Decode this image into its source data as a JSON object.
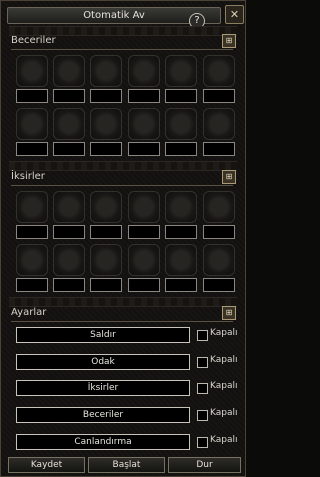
{
  "window": {
    "title": "Otomatik Av"
  },
  "sections": {
    "skills": {
      "label": "Beceriler"
    },
    "potions": {
      "label": "İksirler"
    },
    "settings": {
      "label": "Ayarlar"
    }
  },
  "settings": {
    "rows": [
      {
        "label": "Saldır",
        "status": "Kapalı"
      },
      {
        "label": "Odak",
        "status": "Kapalı"
      },
      {
        "label": "İksirler",
        "status": "Kapalı"
      },
      {
        "label": "Beceriler",
        "status": "Kapalı"
      },
      {
        "label": "Canlandırma",
        "status": "Kapalı"
      }
    ]
  },
  "footer": {
    "save": "Kaydet",
    "start": "Başlat",
    "stop": "Dur"
  },
  "icons": {
    "help": "question-icon",
    "close": "close-icon",
    "toggle": "toggle-icon"
  }
}
